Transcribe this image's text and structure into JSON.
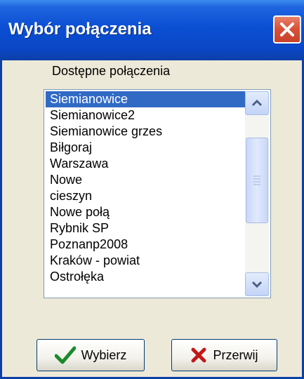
{
  "window": {
    "title": "Wybór połączenia"
  },
  "dialog": {
    "list_label": "Dostępne połączenia",
    "connections": [
      "Siemianowice",
      "Siemianowice2",
      "Siemianowice grzes",
      "Biłgoraj",
      "Warszawa",
      "Nowe",
      "cieszyn",
      "Nowe połą",
      "Rybnik SP",
      "Poznanp2008",
      "Kraków - powiat",
      "Ostrołęka"
    ],
    "selected_index": 0
  },
  "buttons": {
    "select_label": "Wybierz",
    "cancel_label": "Przerwij"
  },
  "icons": {
    "close": "close-icon",
    "select": "checkmark-icon",
    "cancel": "x-icon"
  },
  "colors": {
    "titlebar": "#0b4fd4",
    "selection": "#316ac5",
    "close": "#d9533a"
  }
}
